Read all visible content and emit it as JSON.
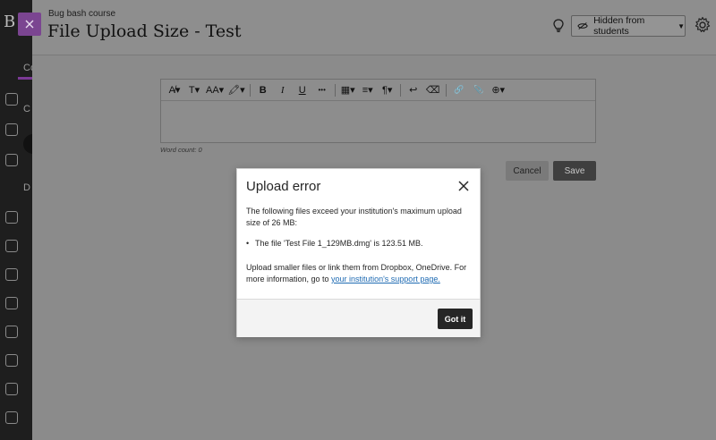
{
  "panel": {
    "breadcrumb": "Bug bash course",
    "title": "File Upload Size - Test",
    "visibility_label": "Hidden from students",
    "word_count": "Word count: 0",
    "cancel_label": "Cancel",
    "save_label": "Save"
  },
  "left_nav": {
    "letter": "B",
    "labels": [
      "Co",
      "C",
      "D"
    ]
  },
  "toolbar": {
    "items": [
      {
        "icon": "text-style-icon",
        "glyph": "A̸▾"
      },
      {
        "icon": "paragraph-style-icon",
        "glyph": "T▾"
      },
      {
        "icon": "font-size-icon",
        "glyph": "AA▾"
      },
      {
        "icon": "text-color-icon",
        "glyph": "🖍▾"
      },
      {
        "icon": "bold-icon",
        "glyph": "B"
      },
      {
        "icon": "italic-icon",
        "glyph": "I"
      },
      {
        "icon": "underline-icon",
        "glyph": "U"
      },
      {
        "icon": "more-icon",
        "glyph": "•••"
      },
      {
        "icon": "table-icon",
        "glyph": "▦▾"
      },
      {
        "icon": "align-icon",
        "glyph": "≡▾"
      },
      {
        "icon": "paragraph-icon",
        "glyph": "¶▾"
      },
      {
        "icon": "undo-icon",
        "glyph": "↩"
      },
      {
        "icon": "clear-format-icon",
        "glyph": "⌫"
      },
      {
        "icon": "link-icon",
        "glyph": "🔗"
      },
      {
        "icon": "attach-icon",
        "glyph": "📎"
      },
      {
        "icon": "insert-icon",
        "glyph": "⊕▾"
      }
    ]
  },
  "modal": {
    "title": "Upload error",
    "intro": "The following files exceed your institution's maximum upload size of 26 MB:",
    "files": [
      "The file 'Test File 1_129MB.dmg' is 123.51 MB."
    ],
    "outro_text": "Upload smaller files or link them from Dropbox, OneDrive. For more information, go to ",
    "outro_link": "your institution's support page.",
    "got_it_label": "Got it"
  },
  "colors": {
    "accent_purple": "#7b4591",
    "link_blue": "#1f6bb3",
    "button_dark": "#262626"
  }
}
